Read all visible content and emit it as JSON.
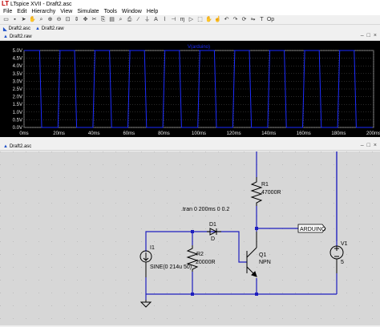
{
  "window": {
    "title": "LTspice XVII - Draft2.asc",
    "logo": "LT"
  },
  "menu": [
    "File",
    "Edit",
    "Hierarchy",
    "View",
    "Simulate",
    "Tools",
    "Window",
    "Help"
  ],
  "toolbar_icons": [
    "folder-icon",
    "save-icon",
    "run-icon",
    "halt-icon",
    "zoom-icon",
    "zoom-in-icon",
    "zoom-out-icon",
    "zoom-fit-icon",
    "autorange-icon",
    "pan-icon",
    "cut-icon",
    "copy-icon",
    "paste-icon",
    "find-icon",
    "print-icon",
    "wire-icon",
    "ground-icon",
    "label-icon",
    "resistor-icon",
    "capacitor-icon",
    "inductor-icon",
    "diode-icon",
    "component-icon",
    "move-icon",
    "drag-icon",
    "undo-icon",
    "redo-icon",
    "rotate-icon",
    "mirror-icon",
    "text-icon",
    "spice-directive-icon"
  ],
  "tabs": [
    {
      "label": "Draft2.asc"
    },
    {
      "label": "Draft2.raw"
    }
  ],
  "waveform_panel": {
    "title": "Draft2.raw"
  },
  "schematic_panel": {
    "title": "Draft2.asc"
  },
  "accent_colors": {
    "trace": "#1c2cff",
    "wire": "#1e1ebe",
    "grid_dot": "#e0e0e0",
    "component": "#000000"
  },
  "chart_data": {
    "type": "line",
    "title": "V(arduino)",
    "xlabel": "",
    "ylabel": "",
    "xlim": [
      0,
      200
    ],
    "ylim": [
      0,
      5
    ],
    "x_ticks": [
      "0ms",
      "20ms",
      "40ms",
      "60ms",
      "80ms",
      "100ms",
      "120ms",
      "140ms",
      "160ms",
      "180ms",
      "200ms"
    ],
    "y_ticks": [
      "0.0V",
      "0.5V",
      "1.0V",
      "1.5V",
      "2.0V",
      "2.5V",
      "3.0V",
      "3.5V",
      "4.0V",
      "4.5V",
      "5.0V"
    ],
    "grid": true,
    "series": [
      {
        "name": "V(arduino)",
        "square_wave": {
          "high": 5.0,
          "low": 0.0,
          "period_ms": 20,
          "high_start_ms": 0,
          "low_start_ms": 9.5
        }
      }
    ]
  },
  "schematic": {
    "directive": ".tran 0 200ms 0 0.2",
    "components": [
      {
        "ref": "I1",
        "value": "SINE(0 214u 50)"
      },
      {
        "ref": "R2",
        "value": "20000R"
      },
      {
        "ref": "D1",
        "value": "D"
      },
      {
        "ref": "Q1",
        "value": "NPN"
      },
      {
        "ref": "R1",
        "value": "47000R"
      },
      {
        "ref": "V1",
        "value": "5"
      }
    ],
    "net_label": "ARDUINO"
  }
}
